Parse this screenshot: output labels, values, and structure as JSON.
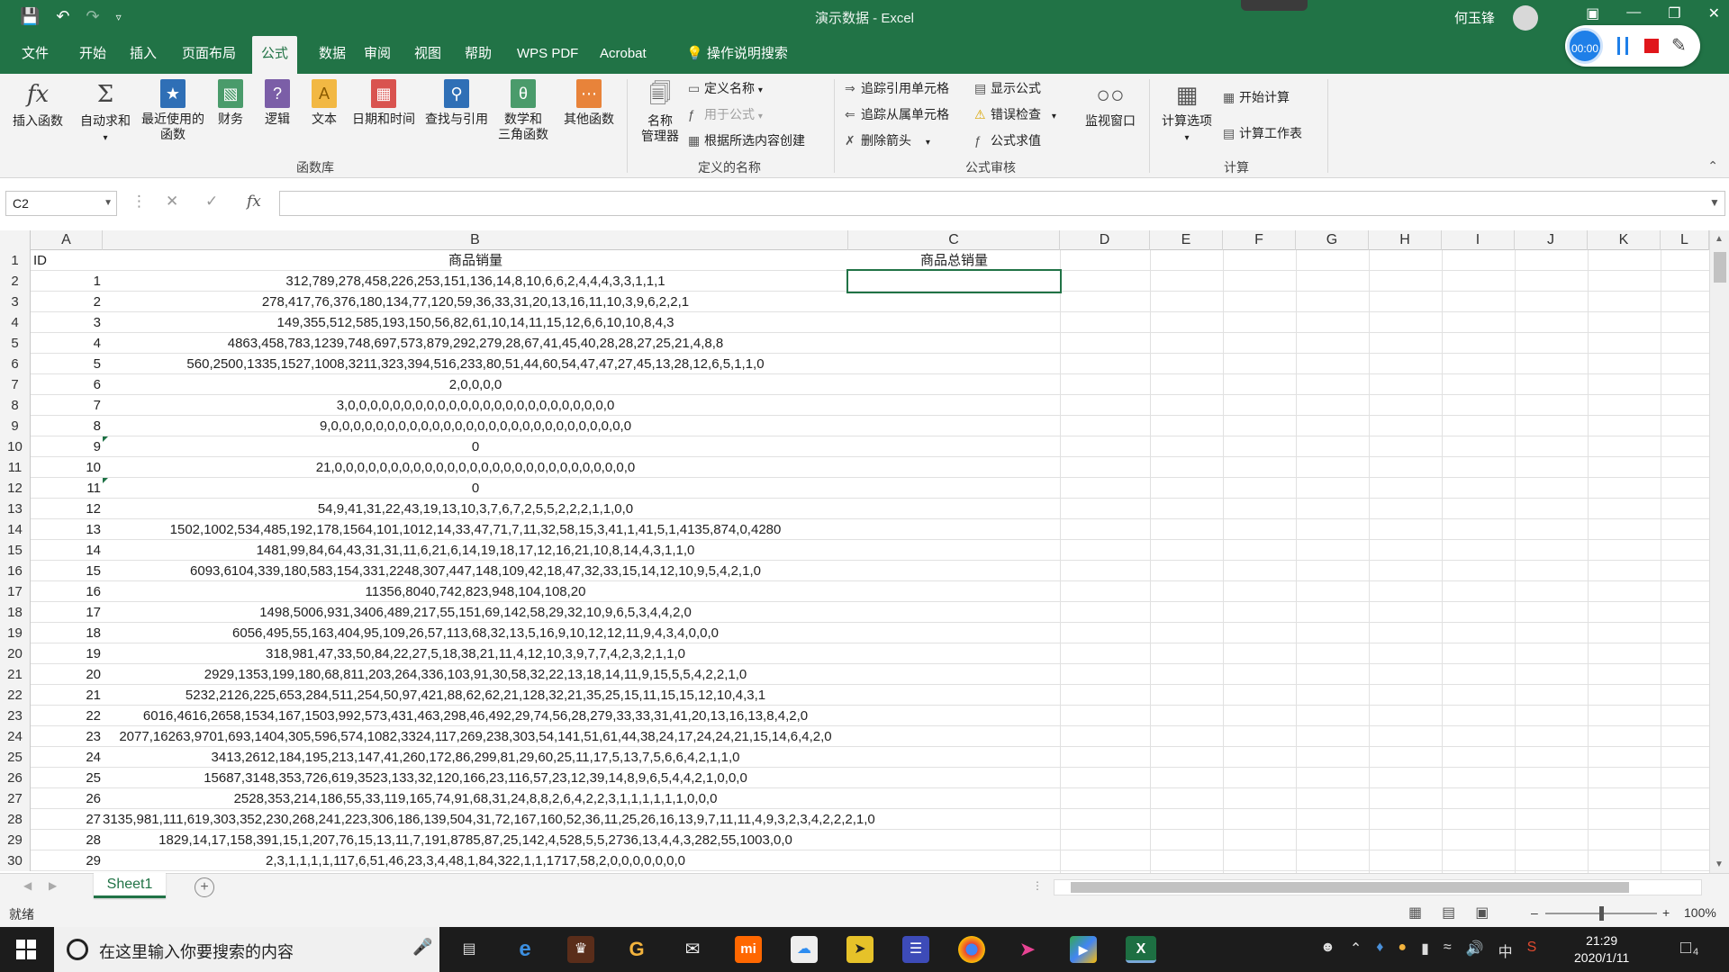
{
  "window": {
    "title": "演示数据 - Excel",
    "user": "何玉锋"
  },
  "recorder": {
    "timer": "00:00"
  },
  "tabs": [
    {
      "label": "文件"
    },
    {
      "label": "开始"
    },
    {
      "label": "插入"
    },
    {
      "label": "页面布局"
    },
    {
      "label": "公式"
    },
    {
      "label": "数据"
    },
    {
      "label": "审阅"
    },
    {
      "label": "视图"
    },
    {
      "label": "帮助"
    },
    {
      "label": "WPS PDF"
    },
    {
      "label": "Acrobat"
    },
    {
      "label": "操作说明搜索"
    }
  ],
  "ribbon": {
    "library": {
      "insert_function": "插入函数",
      "autosum": "自动求和",
      "recent_1": "最近使用的",
      "recent_2": "函数",
      "financial": "财务",
      "logical": "逻辑",
      "text": "文本",
      "datetime": "日期和时间",
      "lookup": "查找与引用",
      "math_1": "数学和",
      "math_2": "三角函数",
      "more": "其他函数",
      "group_label": "函数库"
    },
    "names": {
      "manager_1": "名称",
      "manager_2": "管理器",
      "define": "定义名称",
      "use_in_formula": "用于公式",
      "create_from_selection": "根据所选内容创建",
      "group_label": "定义的名称"
    },
    "audit": {
      "trace_precedents": "追踪引用单元格",
      "trace_dependents": "追踪从属单元格",
      "remove_arrows": "删除箭头",
      "show_formulas": "显示公式",
      "error_checking": "错误检查",
      "evaluate": "公式求值",
      "watch": "监视窗口",
      "group_label": "公式审核"
    },
    "calc": {
      "options": "计算选项",
      "calc_now": "开始计算",
      "calc_sheet": "计算工作表",
      "group_label": "计算"
    }
  },
  "formula_bar": {
    "name_box": "C2",
    "formula": ""
  },
  "columns": [
    "A",
    "B",
    "C",
    "D",
    "E",
    "F",
    "G",
    "H",
    "I",
    "J",
    "K",
    "L"
  ],
  "rows": [
    {
      "num": "1",
      "a": "ID",
      "b": "商品销量",
      "c": "商品总销量"
    },
    {
      "num": "2",
      "a": "1",
      "b": "312,789,278,458,226,253,151,136,14,8,10,6,6,2,4,4,4,3,3,1,1,1",
      "c": ""
    },
    {
      "num": "3",
      "a": "2",
      "b": "278,417,76,376,180,134,77,120,59,36,33,31,20,13,16,11,10,3,9,6,2,2,1",
      "c": ""
    },
    {
      "num": "4",
      "a": "3",
      "b": "149,355,512,585,193,150,56,82,61,10,14,11,15,12,6,6,10,10,8,4,3",
      "c": ""
    },
    {
      "num": "5",
      "a": "4",
      "b": "4863,458,783,1239,748,697,573,879,292,279,28,67,41,45,40,28,28,27,25,21,4,8,8",
      "c": ""
    },
    {
      "num": "6",
      "a": "5",
      "b": "560,2500,1335,1527,1008,3211,323,394,516,233,80,51,44,60,54,47,47,27,45,13,28,12,6,5,1,1,0",
      "c": ""
    },
    {
      "num": "7",
      "a": "6",
      "b": "2,0,0,0,0",
      "c": ""
    },
    {
      "num": "8",
      "a": "7",
      "b": "3,0,0,0,0,0,0,0,0,0,0,0,0,0,0,0,0,0,0,0,0,0,0,0,0",
      "c": ""
    },
    {
      "num": "9",
      "a": "8",
      "b": "9,0,0,0,0,0,0,0,0,0,0,0,0,0,0,0,0,0,0,0,0,0,0,0,0,0,0,0",
      "c": ""
    },
    {
      "num": "10",
      "a": "9",
      "b": "0",
      "c": "",
      "flag": true
    },
    {
      "num": "11",
      "a": "10",
      "b": "21,0,0,0,0,0,0,0,0,0,0,0,0,0,0,0,0,0,0,0,0,0,0,0,0,0,0,0",
      "c": ""
    },
    {
      "num": "12",
      "a": "11",
      "b": "0",
      "c": "",
      "flag": true
    },
    {
      "num": "13",
      "a": "12",
      "b": "54,9,41,31,22,43,19,13,10,3,7,6,7,2,5,5,2,2,2,1,1,0,0",
      "c": ""
    },
    {
      "num": "14",
      "a": "13",
      "b": "1502,1002,534,485,192,178,1564,101,1012,14,33,47,71,7,11,32,58,15,3,41,1,41,5,1,4135,874,0,4280",
      "c": ""
    },
    {
      "num": "15",
      "a": "14",
      "b": "1481,99,84,64,43,31,31,11,6,21,6,14,19,18,17,12,16,21,10,8,14,4,3,1,1,0",
      "c": ""
    },
    {
      "num": "16",
      "a": "15",
      "b": "6093,6104,339,180,583,154,331,2248,307,447,148,109,42,18,47,32,33,15,14,12,10,9,5,4,2,1,0",
      "c": ""
    },
    {
      "num": "17",
      "a": "16",
      "b": "11356,8040,742,823,948,104,108,20",
      "c": ""
    },
    {
      "num": "18",
      "a": "17",
      "b": "1498,5006,931,3406,489,217,55,151,69,142,58,29,32,10,9,6,5,3,4,4,2,0",
      "c": ""
    },
    {
      "num": "19",
      "a": "18",
      "b": "6056,495,55,163,404,95,109,26,57,113,68,32,13,5,16,9,10,12,12,11,9,4,3,4,0,0,0",
      "c": ""
    },
    {
      "num": "20",
      "a": "19",
      "b": "318,981,47,33,50,84,22,27,5,18,38,21,11,4,12,10,3,9,7,7,4,2,3,2,1,1,0",
      "c": ""
    },
    {
      "num": "21",
      "a": "20",
      "b": "2929,1353,199,180,68,811,203,264,336,103,91,30,58,32,22,13,18,14,11,9,15,5,5,4,2,2,1,0",
      "c": ""
    },
    {
      "num": "22",
      "a": "21",
      "b": "5232,2126,225,653,284,511,254,50,97,421,88,62,62,21,128,32,21,35,25,15,11,15,15,12,10,4,3,1",
      "c": ""
    },
    {
      "num": "23",
      "a": "22",
      "b": "6016,4616,2658,1534,167,1503,992,573,431,463,298,46,492,29,74,56,28,279,33,33,31,41,20,13,16,13,8,4,2,0",
      "c": ""
    },
    {
      "num": "24",
      "a": "23",
      "b": "2077,16263,9701,693,1404,305,596,574,1082,3324,117,269,238,303,54,141,51,61,44,38,24,17,24,24,21,15,14,6,4,2,0",
      "c": ""
    },
    {
      "num": "25",
      "a": "24",
      "b": "3413,2612,184,195,213,147,41,260,172,86,299,81,29,60,25,11,17,5,13,7,5,6,6,4,2,1,1,0",
      "c": ""
    },
    {
      "num": "26",
      "a": "25",
      "b": "15687,3148,353,726,619,3523,133,32,120,166,23,116,57,23,12,39,14,8,9,6,5,4,4,2,1,0,0,0",
      "c": ""
    },
    {
      "num": "27",
      "a": "26",
      "b": "2528,353,214,186,55,33,119,165,74,91,68,31,24,8,8,2,6,4,2,2,3,1,1,1,1,1,1,0,0,0",
      "c": ""
    },
    {
      "num": "28",
      "a": "27",
      "b": "3135,981,111,619,303,352,230,268,241,223,306,186,139,504,31,72,167,160,52,36,11,25,26,16,13,9,7,11,11,4,9,3,2,3,4,2,2,2,1,0",
      "c": ""
    },
    {
      "num": "29",
      "a": "28",
      "b": "1829,14,17,158,391,15,1,207,76,15,13,11,7,191,8785,87,25,142,4,528,5,5,2736,13,4,4,3,282,55,1003,0,0",
      "c": ""
    },
    {
      "num": "30",
      "a": "29",
      "b": "2,3,1,1,1,1,117,6,51,46,23,3,4,48,1,84,322,1,1,1717,58,2,0,0,0,0,0,0,0",
      "c": ""
    }
  ],
  "sheet_tab": "Sheet1",
  "status": {
    "ready": "就绪",
    "zoom": "100%"
  },
  "taskbar": {
    "search_placeholder": "在这里输入你要搜索的内容",
    "time": "21:29",
    "date": "2020/1/11",
    "notif_count": "4"
  }
}
